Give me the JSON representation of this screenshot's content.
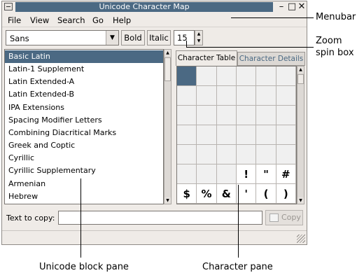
{
  "window": {
    "title": "Unicode Character Map"
  },
  "menubar": {
    "items": [
      "File",
      "View",
      "Search",
      "Go",
      "Help"
    ]
  },
  "toolbar": {
    "font": "Sans",
    "bold_label": "Bold",
    "italic_label": "Italic",
    "zoom_value": "15"
  },
  "blocks": {
    "selected": "Basic Latin",
    "items": [
      "Basic Latin",
      "Latin-1 Supplement",
      "Latin Extended-A",
      "Latin Extended-B",
      "IPA Extensions",
      "Spacing Modifier Letters",
      "Combining Diacritical Marks",
      "Greek and Coptic",
      "Cyrillic",
      "Cyrillic Supplementary",
      "Armenian",
      "Hebrew"
    ]
  },
  "tabs": [
    "Character Table",
    "Character Details"
  ],
  "grid": {
    "rows": [
      [
        "",
        "",
        "",
        "",
        "",
        ""
      ],
      [
        "",
        "",
        "",
        "",
        "",
        ""
      ],
      [
        "",
        "",
        "",
        "",
        "",
        ""
      ],
      [
        "",
        "",
        "",
        "",
        "",
        ""
      ],
      [
        "",
        "",
        "",
        "",
        "",
        ""
      ],
      [
        "",
        "",
        "",
        "!",
        "\"",
        "#"
      ],
      [
        "$",
        "%",
        "&",
        "'",
        "(",
        ")"
      ]
    ]
  },
  "copy": {
    "label": "Text to copy:",
    "value": "",
    "button": "Copy"
  },
  "callouts": {
    "menubar": "Menubar",
    "zoom_line1": "Zoom",
    "zoom_line2": "spin box",
    "block_pane": "Unicode block pane",
    "character_pane": "Character pane"
  },
  "colors": {
    "selection": "#4b6983",
    "window_bg": "#efebe7"
  }
}
